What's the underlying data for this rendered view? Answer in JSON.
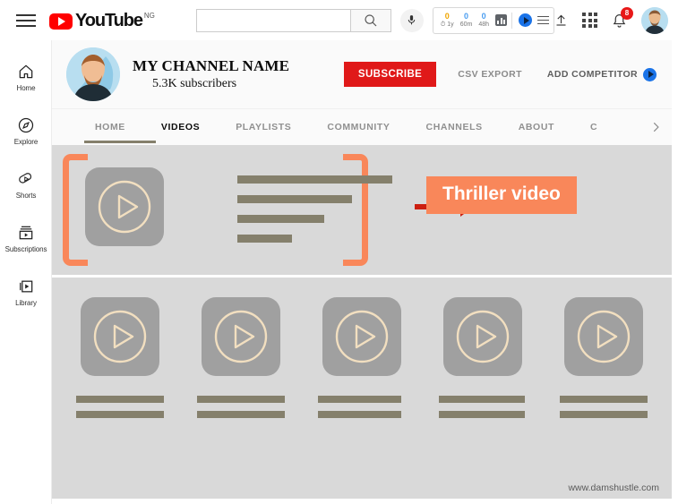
{
  "topbar": {
    "menu_icon": "hamburger-menu-icon",
    "logo_text": "YouTube",
    "logo_country_code": "NG",
    "search_value": "",
    "search_placeholder": "",
    "search_icon": "search-icon",
    "mic_icon": "microphone-icon",
    "upload_icon": "upload-icon",
    "apps_icon": "apps-grid-icon",
    "bell_icon": "notifications-bell-icon",
    "notification_count": "8",
    "avatar": "user-avatar"
  },
  "extension_widget": {
    "stats": [
      {
        "num": "0",
        "label": "1y",
        "color": "#f0a500",
        "has_clock": true
      },
      {
        "num": "0",
        "label": "60m",
        "color": "#4a9df0",
        "has_clock": false
      },
      {
        "num": "0",
        "label": "48h",
        "color": "#4a9df0",
        "has_clock": false
      }
    ],
    "chart_icon": "bar-chart-icon",
    "brand_icon": "vidiq-play-icon",
    "menu_icon": "widget-menu-icon"
  },
  "sidebar": {
    "items": [
      {
        "label": "Home",
        "icon": "home-icon"
      },
      {
        "label": "Explore",
        "icon": "compass-explore-icon"
      },
      {
        "label": "Shorts",
        "icon": "shorts-icon"
      },
      {
        "label": "Subscriptions",
        "icon": "subscriptions-icon"
      },
      {
        "label": "Library",
        "icon": "library-icon"
      }
    ]
  },
  "channel": {
    "avatar": "channel-avatar",
    "name": "MY CHANNEL NAME",
    "subscribers": "5.3K subscribers",
    "subscribe_label": "SUBSCRIBE",
    "csv_export_label": "CSV EXPORT",
    "add_competitor_label": "ADD COMPETITOR",
    "subscribe_color": "#e01919"
  },
  "tabs": [
    {
      "label": "HOME",
      "active": false,
      "underlined": true
    },
    {
      "label": "VIDEOS",
      "active": true,
      "underlined": false
    },
    {
      "label": "PLAYLISTS",
      "active": false,
      "underlined": false
    },
    {
      "label": "COMMUNITY",
      "active": false,
      "underlined": false
    },
    {
      "label": "CHANNELS",
      "active": false,
      "underlined": false
    },
    {
      "label": "ABOUT",
      "active": false,
      "underlined": false
    },
    {
      "label": "C",
      "active": false,
      "underlined": false
    }
  ],
  "tabs_next_icon": "chevron-right-icon",
  "featured": {
    "bracket_color": "#f9875a",
    "arrow_color": "#cc1f10",
    "callout_label": "Thriller video",
    "callout_bg": "#f9875a",
    "thumbnail_icon": "play-placeholder-icon",
    "title_line_widths": [
      173,
      128,
      97,
      61
    ]
  },
  "video_grid": {
    "placeholder_icon": "play-placeholder-icon",
    "cards": [
      {
        "line_widths": [
          98,
          98
        ]
      },
      {
        "line_widths": [
          98,
          98
        ]
      },
      {
        "line_widths": [
          93,
          93
        ]
      },
      {
        "line_widths": [
          96,
          96
        ]
      },
      {
        "line_widths": [
          98,
          98
        ]
      }
    ]
  },
  "watermark": "www.damshustle.com"
}
